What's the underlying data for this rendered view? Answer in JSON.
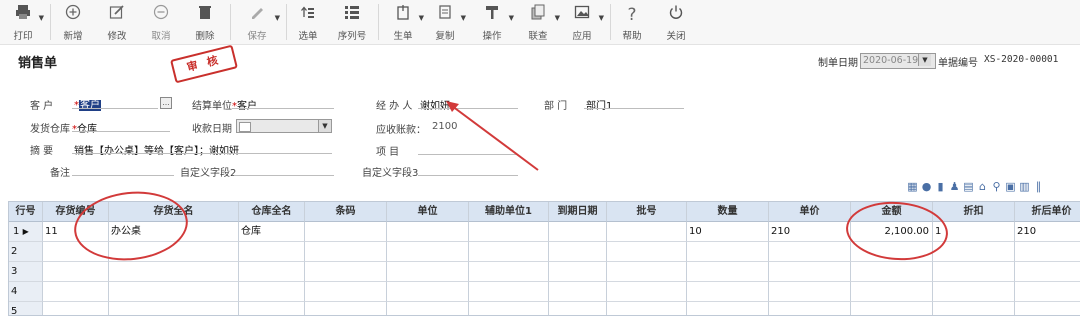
{
  "toolbar": {
    "print": "打印",
    "add": "新增",
    "edit": "修改",
    "cancel": "取消",
    "delete": "删除",
    "save": "保存",
    "select_order": "选单",
    "serial": "序列号",
    "generate": "生单",
    "copy": "复制",
    "operate": "操作",
    "linked": "联查",
    "apply": "应用",
    "help": "帮助",
    "close": "关闭"
  },
  "title": "销售单",
  "stamp": "审 核",
  "header": {
    "date_label": "制单日期",
    "date_value": "2020-06-19",
    "doc_no_label": "单据编号",
    "doc_no_value": "XS-2020-00001"
  },
  "form": {
    "customer_label": "客      户",
    "customer_value": "客户",
    "settle_label": "结算单位",
    "settle_value": "客户",
    "handler_label": "经 办 人",
    "handler_value": "谢如妍",
    "dept_label": "部      门",
    "dept_value": "部门1",
    "warehouse_label": "发货仓库",
    "warehouse_value": "仓库",
    "receive_date_label": "收款日期",
    "receivable_label": "应收账款：",
    "receivable_value": "2100",
    "summary_label": "摘      要",
    "summary_value": "销售【办公桌】等给【客户】；谢如妍",
    "project_label": "项      目",
    "remark_label": "备注",
    "custom2_label": "自定义字段2",
    "custom3_label": "自定义字段3"
  },
  "grid": {
    "headers": [
      "行号",
      "存货编号",
      "存货全名",
      "仓库全名",
      "条码",
      "单位",
      "辅助单位1",
      "到期日期",
      "批号",
      "数量",
      "单价",
      "金额",
      "折扣",
      "折后单价"
    ],
    "rows": [
      {
        "num": "1",
        "code": "11",
        "name": "办公桌",
        "warehouse": "仓库",
        "qty": "10",
        "price": "210",
        "amount": "2,100.00",
        "discount": "1",
        "after_price": "210"
      },
      {
        "num": "2"
      },
      {
        "num": "3"
      },
      {
        "num": "4"
      },
      {
        "num": "5"
      }
    ]
  },
  "colors": {
    "annotation": "#d23a3a",
    "header_bg": "#d9e4f2",
    "toolbar_bg": "#f7f7f7"
  }
}
